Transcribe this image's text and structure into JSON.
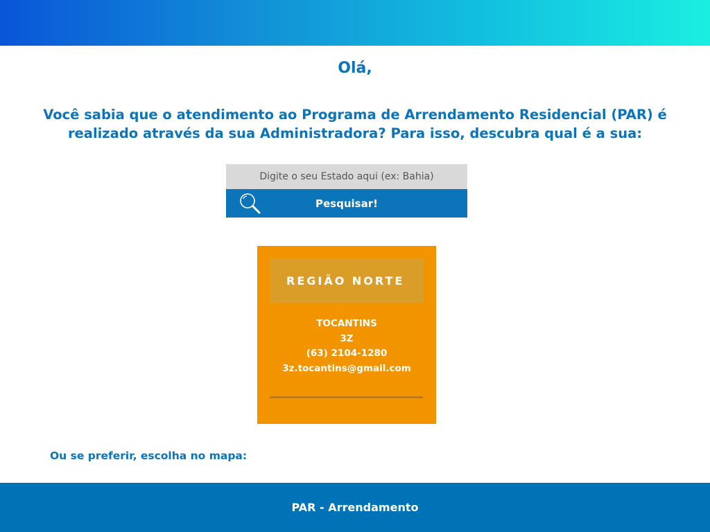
{
  "header": {
    "banner_gradient": [
      "#0a55d8",
      "#1aefe0"
    ]
  },
  "greeting": "Olá,",
  "intro": "Você sabia que o atendimento ao Programa de Arrendamento Residencial (PAR) é realizado através da sua Administradora? Para isso, descubra qual é a sua:",
  "search": {
    "placeholder": "Digite o seu Estado aqui (ex: Bahia)",
    "value": "",
    "button_label": "Pesquisar!",
    "icon": "search-icon"
  },
  "region_card": {
    "title": "REGIÃO NORTE",
    "state": "TOCANTINS",
    "company": "3Z",
    "phone": "(63) 2104-1280",
    "email": "3z.tocantins@gmail.com",
    "background": "#f29300"
  },
  "map_prompt": "Ou se preferir, escolha no mapa:",
  "footer": {
    "text": "PAR - Arrendamento"
  },
  "colors": {
    "accent": "#0c74b8",
    "card": "#f29300"
  }
}
